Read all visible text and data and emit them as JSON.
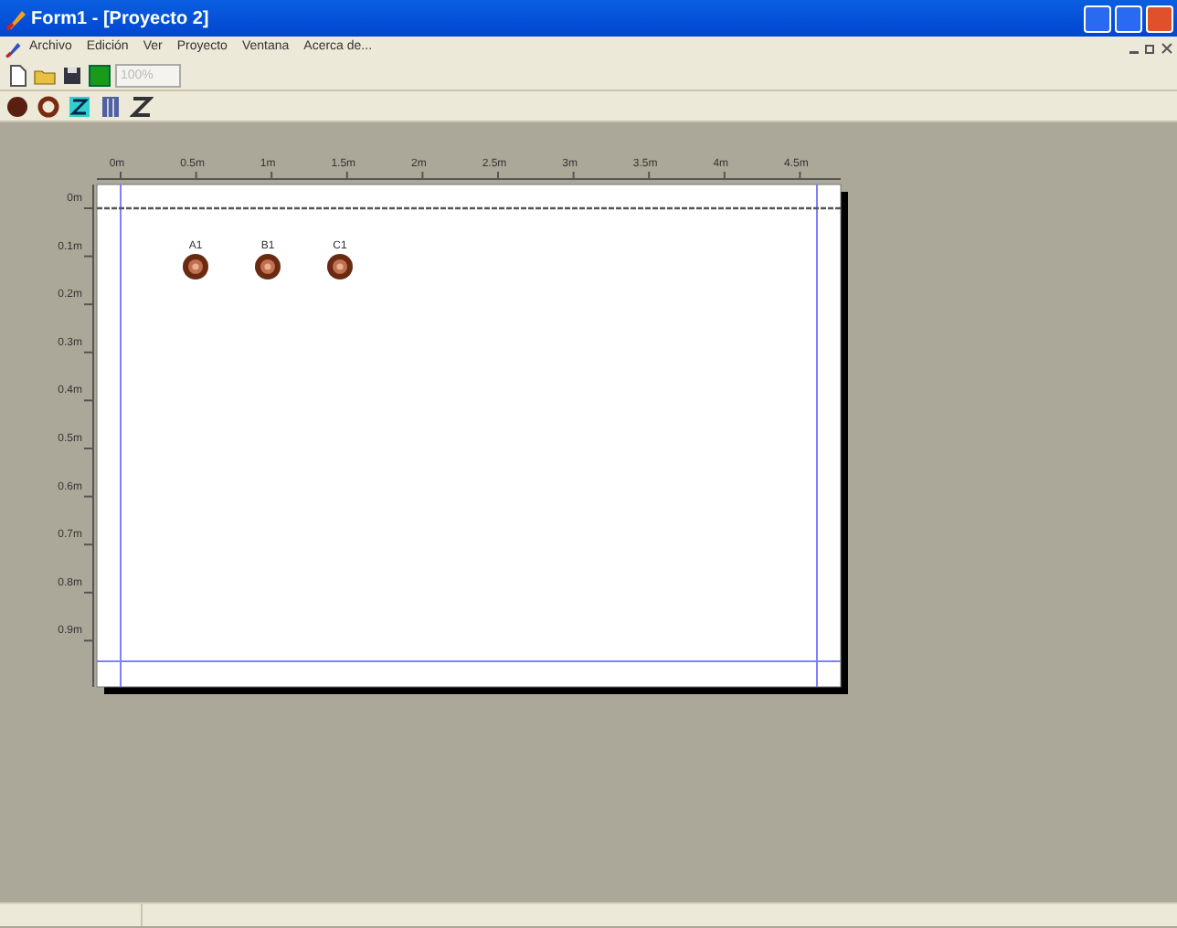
{
  "window": {
    "title": "Form1 - [Proyecto 2]"
  },
  "menu": [
    "Archivo",
    "Edición",
    "Ver",
    "Proyecto",
    "Ventana",
    "Acerca de..."
  ],
  "zoom_field": {
    "value": "100%"
  },
  "ruler": {
    "x_labels": [
      "0m",
      "0.5m",
      "1m",
      "1.5m",
      "2m",
      "2.5m",
      "3m",
      "3.5m",
      "4m",
      "4.5m"
    ],
    "y_labels": [
      "0m",
      "0.1m",
      "0.2m",
      "0.3m",
      "0.4m",
      "0.5m",
      "0.6m",
      "0.7m",
      "0.8m",
      "0.9m"
    ]
  },
  "components": [
    {
      "label": "A1"
    },
    {
      "label": "B1"
    },
    {
      "label": "C1"
    }
  ]
}
